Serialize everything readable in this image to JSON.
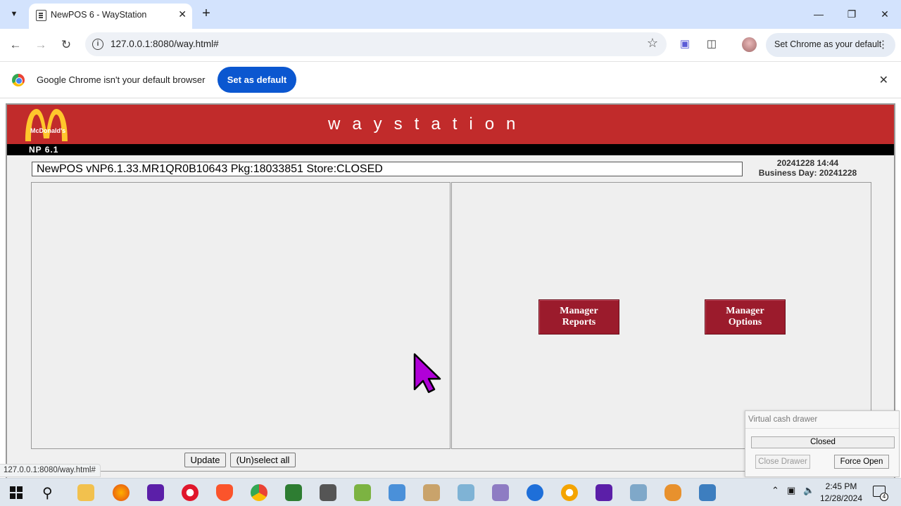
{
  "browser": {
    "tab_title": "NewPOS 6 - WayStation",
    "url": "127.0.0.1:8080/way.html#",
    "set_default_pill": "Set Chrome as your default",
    "infobar_message": "Google Chrome isn't your default browser",
    "infobar_button": "Set as default",
    "status_url": "127.0.0.1:8080/way.html#"
  },
  "waystation": {
    "banner_title": "waystation",
    "logo_text": "McDonald's",
    "np_label": "NP 6.1",
    "status_line": "NewPOS vNP6.1.33.MR1QR0B10643 Pkg:18033851 Store:CLOSED",
    "datetime": "20241228 14:44",
    "business_day": "Business Day: 20241228",
    "manager_reports": "Manager Reports",
    "manager_options": "Manager Options",
    "update_button": "Update",
    "unselect_button": "(Un)select all"
  },
  "cash_drawer": {
    "title": "Virtual cash drawer",
    "state": "Closed",
    "close_button": "Close Drawer",
    "force_open_button": "Force Open"
  },
  "taskbar": {
    "time": "2:45 PM",
    "date": "12/28/2024",
    "notification_count": "4"
  },
  "colors": {
    "banner_red": "#c12b2b",
    "manager_button": "#9b1b2c",
    "chrome_blue": "#0b57d0",
    "cursor": "#b000d8"
  }
}
